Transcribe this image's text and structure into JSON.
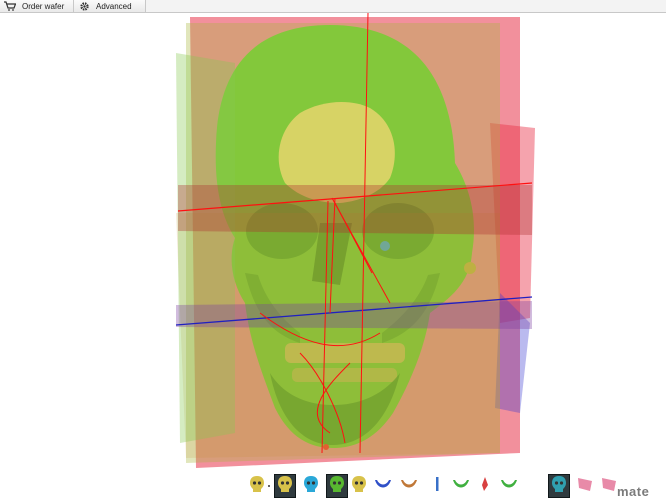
{
  "toolbar": {
    "order_label": "Order wafer",
    "order_icon": "cart-icon",
    "advanced_label": "Advanced",
    "advanced_icon": "gear-icon"
  },
  "viewport": {
    "subject": "skull-3d-model",
    "colors": {
      "bone": "#66cc33",
      "highlight": "#e8e07a",
      "plane_red": "#e8344a",
      "plane_green": "#88c850",
      "plane_blue": "#3a3ad0",
      "guide_line": "#ff1010"
    }
  },
  "thumbnails": [
    {
      "icon": "skull-yellow-icon",
      "selected": false
    },
    {
      "icon": "skull-yellow-icon",
      "selected": true
    },
    {
      "icon": "skull-blue-icon",
      "selected": false
    },
    {
      "icon": "skull-green-icon",
      "selected": true
    },
    {
      "icon": "skull-yellow-icon",
      "selected": false
    },
    {
      "icon": "maxilla-blue-icon",
      "selected": false
    },
    {
      "icon": "mandible-brown-icon",
      "selected": false
    },
    {
      "icon": "ramus-blue-icon",
      "selected": false
    },
    {
      "icon": "mandible-green-icon",
      "selected": false
    },
    {
      "icon": "chin-red-icon",
      "selected": false
    },
    {
      "icon": "mandible-green-icon",
      "selected": false
    },
    {
      "icon": "skull-teal-icon",
      "selected": true
    },
    {
      "icon": "plane-pink-icon",
      "selected": false
    },
    {
      "icon": "plane-pink-icon",
      "selected": false
    }
  ],
  "brand": {
    "logo_text": "mate"
  }
}
